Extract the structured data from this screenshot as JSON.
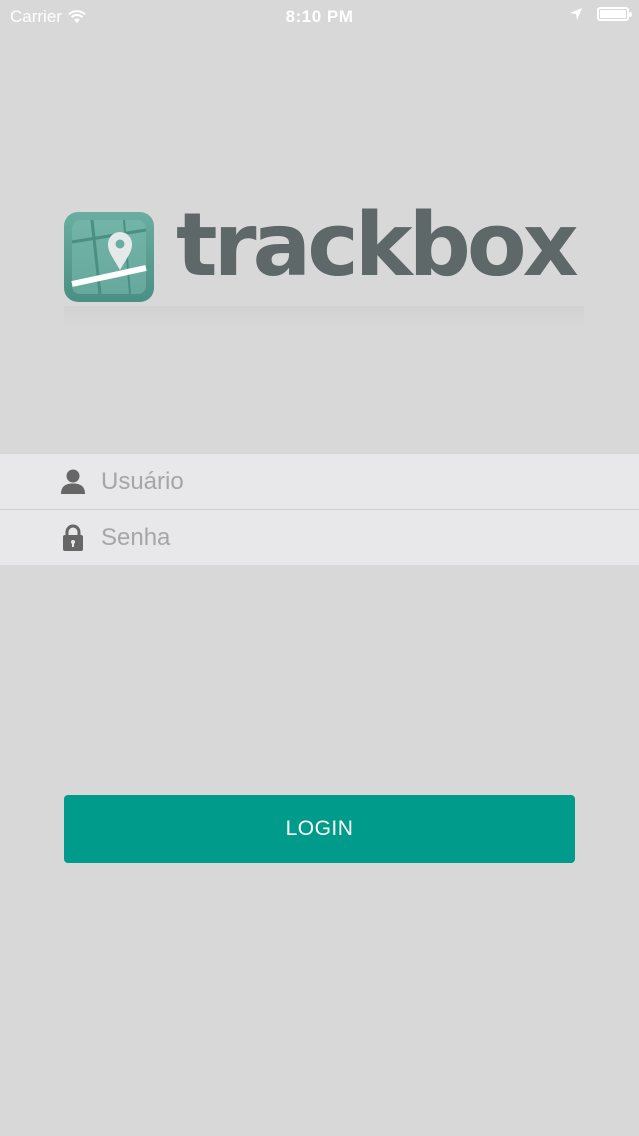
{
  "status_bar": {
    "carrier": "Carrier",
    "time": "8:10 PM",
    "icons": [
      "wifi-icon",
      "location-arrow-icon",
      "battery-icon"
    ]
  },
  "logo": {
    "text": "trackbox",
    "icon": "map-pin-icon",
    "colors": {
      "icon_bg": "#5a9f92",
      "text": "#5e6869"
    }
  },
  "form": {
    "username": {
      "placeholder": "Usuário",
      "value": "",
      "icon": "user-icon"
    },
    "password": {
      "placeholder": "Senha",
      "value": "",
      "icon": "lock-icon"
    }
  },
  "login_button": {
    "label": "LOGIN",
    "color": "#009b8a"
  }
}
